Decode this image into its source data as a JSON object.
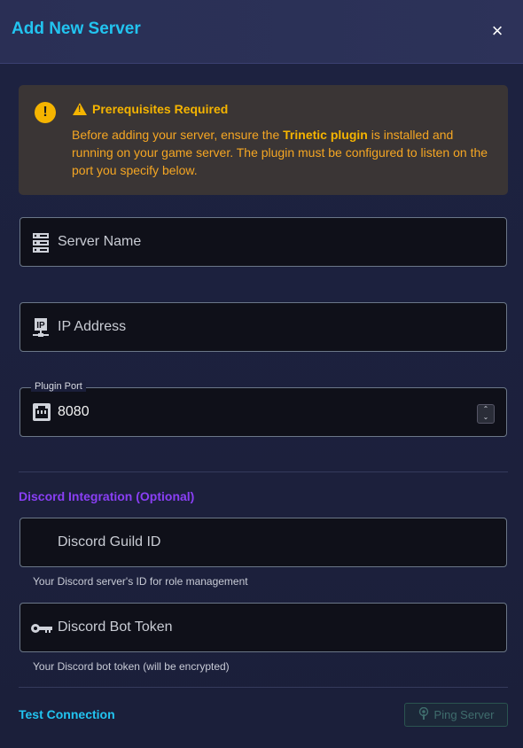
{
  "dialog": {
    "title": "Add New Server",
    "close_label": "×"
  },
  "prereq": {
    "title": "Prerequisites Required",
    "text_before": "Before adding your server, ensure the ",
    "highlight": "Trinetic plugin",
    "text_after": " is installed and running on your game server. The plugin must be configured to listen on the port you specify below."
  },
  "fields": {
    "server_name": {
      "placeholder": "Server Name",
      "icon": "server-icon"
    },
    "ip_address": {
      "placeholder": "IP Address",
      "icon": "ip-icon"
    },
    "plugin_port": {
      "label": "Plugin Port",
      "value": "8080",
      "icon": "ethernet-port-icon"
    }
  },
  "discord": {
    "section_title": "Discord Integration (Optional)",
    "guild_id": {
      "placeholder": "Discord Guild ID",
      "help": "Your Discord server's ID for role management"
    },
    "bot_token": {
      "placeholder": "Discord Bot Token",
      "icon": "key-icon",
      "help": "Your Discord bot token (will be encrypted)"
    }
  },
  "test": {
    "title": "Test Connection",
    "ping_label": "Ping Server",
    "ping_icon": "podcast-icon"
  },
  "colors": {
    "accent": "#22c4f0",
    "warning": "#f5b400",
    "purple": "#8a3ff5"
  }
}
